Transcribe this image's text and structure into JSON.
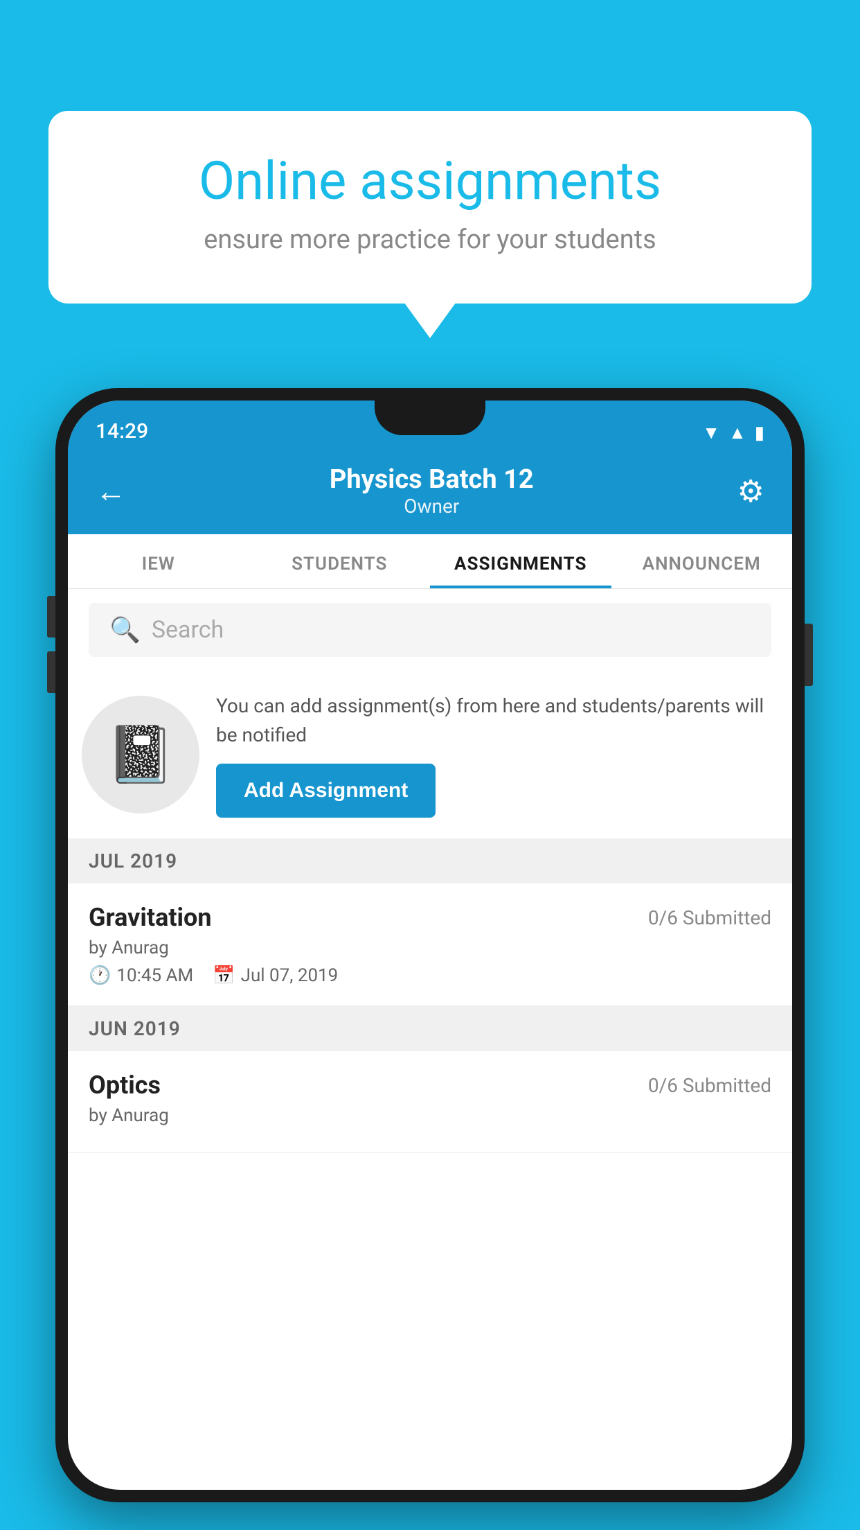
{
  "background_color": "#1ABBE8",
  "speech_bubble": {
    "title": "Online assignments",
    "subtitle": "ensure more practice for your students"
  },
  "status_bar": {
    "time": "14:29",
    "icons": [
      "wifi",
      "signal",
      "battery"
    ]
  },
  "app_header": {
    "back_label": "←",
    "title": "Physics Batch 12",
    "subtitle": "Owner",
    "settings_label": "⚙"
  },
  "tabs": [
    {
      "label": "IEW",
      "active": false
    },
    {
      "label": "STUDENTS",
      "active": false
    },
    {
      "label": "ASSIGNMENTS",
      "active": true
    },
    {
      "label": "ANNOUNCEM",
      "active": false
    }
  ],
  "search": {
    "placeholder": "Search"
  },
  "promo": {
    "description": "You can add assignment(s) from here and students/parents will be notified",
    "button_label": "Add Assignment"
  },
  "sections": [
    {
      "month_label": "JUL 2019",
      "assignments": [
        {
          "name": "Gravitation",
          "submitted": "0/6 Submitted",
          "author": "by Anurag",
          "time": "10:45 AM",
          "date": "Jul 07, 2019"
        }
      ]
    },
    {
      "month_label": "JUN 2019",
      "assignments": [
        {
          "name": "Optics",
          "submitted": "0/6 Submitted",
          "author": "by Anurag",
          "time": "",
          "date": ""
        }
      ]
    }
  ]
}
